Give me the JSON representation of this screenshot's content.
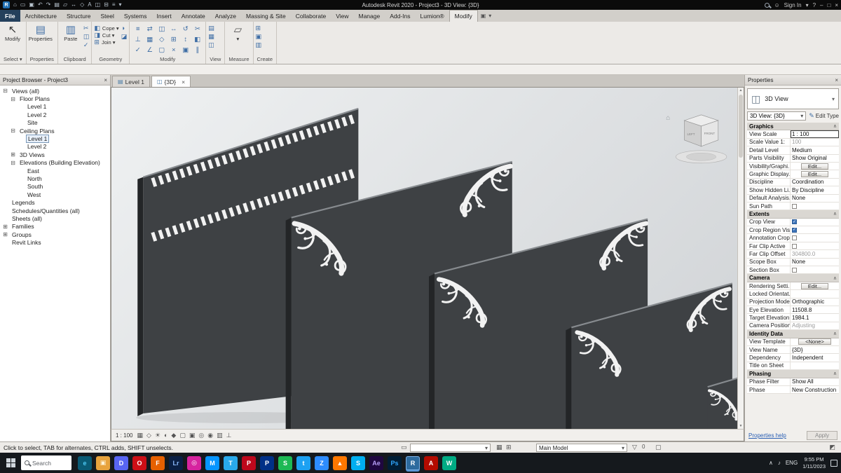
{
  "colors": {
    "accent": "#3c73b9",
    "panel_face": "#3e4144",
    "panel_side": "#232527",
    "ornament": "#f2f2f2",
    "taskbar_bg": "#15191d"
  },
  "title_bar": {
    "title": "Autodesk Revit 2020 - Project3 - 3D View: {3D}",
    "sign_in_label": "Sign In",
    "quick_access_icons": [
      {
        "name": "app-home-icon",
        "glyph": "⌂"
      },
      {
        "name": "open-file-icon",
        "glyph": "▭"
      },
      {
        "name": "save-icon",
        "glyph": "▣"
      },
      {
        "name": "undo-icon",
        "glyph": "↶"
      },
      {
        "name": "redo-icon",
        "glyph": "↷"
      },
      {
        "name": "print-icon",
        "glyph": "▤"
      },
      {
        "name": "measure-icon",
        "glyph": "▱"
      },
      {
        "name": "aligned-dimension-icon",
        "glyph": "↔"
      },
      {
        "name": "tag-icon",
        "glyph": "◇"
      },
      {
        "name": "text-icon",
        "glyph": "A"
      },
      {
        "name": "default-3d-view-icon",
        "glyph": "◫"
      },
      {
        "name": "section-icon",
        "glyph": "⊟"
      },
      {
        "name": "thin-lines-icon",
        "glyph": "≡"
      },
      {
        "name": "customize-qat-icon",
        "glyph": "▾"
      }
    ],
    "help_icon": "?",
    "minimize": "–",
    "maximize": "□",
    "close": "×",
    "user_icon": "☺",
    "workspace_arrow": "▾"
  },
  "ribbon": {
    "tabs": [
      "File",
      "Architecture",
      "Structure",
      "Steel",
      "Systems",
      "Insert",
      "Annotate",
      "Analyze",
      "Massing & Site",
      "Collaborate",
      "View",
      "Manage",
      "Add-Ins",
      "Lumion®",
      "Modify"
    ],
    "active_tab": "Modify",
    "extra_icons": [
      {
        "name": "modify-state-icon",
        "glyph": "▣"
      },
      {
        "name": "ribbon-collapse-icon",
        "glyph": "▾"
      }
    ],
    "panels": [
      {
        "label": "Select ▾",
        "big": [
          {
            "name": "modify-tool",
            "glyph": "↖",
            "text": "Modify",
            "color": "#333"
          }
        ]
      },
      {
        "label": "Properties",
        "big": [
          {
            "name": "properties",
            "glyph": "▤",
            "text": "Properties"
          }
        ]
      },
      {
        "label": "Clipboard",
        "big": [
          {
            "name": "paste",
            "glyph": "▥",
            "text": "Paste"
          }
        ],
        "small": [
          {
            "name": "cut-to-clipboard-icon",
            "glyph": "✂"
          },
          {
            "name": "copy-to-clipboard-icon",
            "glyph": "◫"
          },
          {
            "name": "match-type-icon",
            "glyph": "✓"
          }
        ]
      },
      {
        "label": "Geometry",
        "rows": [
          {
            "name": "cope",
            "glyph": "◧",
            "text": "Cope ▾"
          },
          {
            "name": "cut",
            "glyph": "◨",
            "text": "Cut ▾"
          },
          {
            "name": "join",
            "glyph": "⊞",
            "text": "Join ▾"
          }
        ],
        "small": [
          {
            "name": "paint-icon",
            "glyph": "◑"
          },
          {
            "name": "split-face-icon",
            "glyph": "◪"
          }
        ]
      },
      {
        "label": "Modify",
        "grid": [
          {
            "name": "align-icon",
            "glyph": "≡"
          },
          {
            "name": "offset-icon",
            "glyph": "⇄"
          },
          {
            "name": "mirror-icon",
            "glyph": "◫"
          },
          {
            "name": "move-icon",
            "glyph": "↔"
          },
          {
            "name": "rotate-icon",
            "glyph": "↺"
          },
          {
            "name": "split-element-icon",
            "glyph": "✂"
          },
          {
            "name": "trim-extend-icon",
            "glyph": "⊥"
          },
          {
            "name": "array-icon",
            "glyph": "▦"
          },
          {
            "name": "scale-icon",
            "glyph": "◇"
          },
          {
            "name": "copy-icon",
            "glyph": "⊞"
          },
          {
            "name": "move-vertical-icon",
            "glyph": "↕"
          },
          {
            "name": "cut-geometry-icon",
            "glyph": "◧"
          },
          {
            "name": "match-properties-icon",
            "glyph": "✓"
          },
          {
            "name": "measure-angle-icon",
            "glyph": "∠"
          },
          {
            "name": "pin-icon",
            "glyph": "▢"
          },
          {
            "name": "delete-icon",
            "glyph": "×"
          },
          {
            "name": "paint-small-icon",
            "glyph": "▣"
          },
          {
            "name": "wall-joins-icon",
            "glyph": "∥"
          }
        ]
      },
      {
        "label": "View",
        "small": [
          {
            "name": "thin-lines-icon",
            "glyph": "▤"
          },
          {
            "name": "user-interface-icon",
            "glyph": "▦"
          },
          {
            "name": "switch-windows-icon",
            "glyph": "◫"
          }
        ]
      },
      {
        "label": "Measure",
        "big": [
          {
            "name": "measure",
            "glyph": "▱",
            "text": "▾",
            "color": "#555"
          }
        ]
      },
      {
        "label": "Create",
        "small": [
          {
            "name": "create-group-icon",
            "glyph": "⊞"
          },
          {
            "name": "create-similar-icon",
            "glyph": "▣"
          },
          {
            "name": "load-family-icon",
            "glyph": "▥"
          }
        ]
      }
    ]
  },
  "project_browser": {
    "title": "Project Browser - Project3",
    "items": [
      {
        "label": "Views (all)",
        "level": 0,
        "exp": "minus"
      },
      {
        "label": "Floor Plans",
        "level": 1,
        "exp": "minus"
      },
      {
        "label": "Level 1",
        "level": 2
      },
      {
        "label": "Level 2",
        "level": 2
      },
      {
        "label": "Site",
        "level": 2
      },
      {
        "label": "Ceiling Plans",
        "level": 1,
        "exp": "minus"
      },
      {
        "label": "Level 1",
        "level": 2,
        "selected": true
      },
      {
        "label": "Level 2",
        "level": 2
      },
      {
        "label": "3D Views",
        "level": 1,
        "exp": "plus"
      },
      {
        "label": "Elevations (Building Elevation)",
        "level": 1,
        "exp": "minus"
      },
      {
        "label": "East",
        "level": 2
      },
      {
        "label": "North",
        "level": 2
      },
      {
        "label": "South",
        "level": 2
      },
      {
        "label": "West",
        "level": 2
      },
      {
        "label": "Legends",
        "level": 0
      },
      {
        "label": "Schedules/Quantities (all)",
        "level": 0
      },
      {
        "label": "Sheets (all)",
        "level": 0
      },
      {
        "label": "Families",
        "level": 0,
        "exp": "plus"
      },
      {
        "label": "Groups",
        "level": 0,
        "exp": "plus"
      },
      {
        "label": "Revit Links",
        "level": 0
      }
    ]
  },
  "viewport": {
    "view_tabs": [
      {
        "label": "Level 1",
        "icon": "▤",
        "active": false,
        "closable": false
      },
      {
        "label": "{3D}",
        "icon": "◫",
        "active": true,
        "closable": true
      }
    ],
    "close_glyph": "×",
    "view_scale": "1 : 100",
    "viewcube": {
      "front_label": "FRONT",
      "left_label": "LEFT",
      "home_glyph": "⌂"
    },
    "control_icons": [
      {
        "name": "detail-level-icon",
        "glyph": "▦"
      },
      {
        "name": "visual-style-icon",
        "glyph": "◇"
      },
      {
        "name": "sun-path-icon",
        "glyph": "☀"
      },
      {
        "name": "shadows-icon",
        "glyph": "◐"
      },
      {
        "name": "rendering-dialog-icon",
        "glyph": "◆"
      },
      {
        "name": "crop-view-icon",
        "glyph": "▢"
      },
      {
        "name": "show-crop-region-icon",
        "glyph": "▣"
      },
      {
        "name": "temporary-hide-isolate-icon",
        "glyph": "◎"
      },
      {
        "name": "reveal-hidden-elements-icon",
        "glyph": "◉"
      },
      {
        "name": "temporary-view-properties-icon",
        "glyph": "▥"
      },
      {
        "name": "constraints-icon",
        "glyph": "⊥"
      }
    ]
  },
  "properties_panel": {
    "title": "Properties",
    "element_type": "3D View",
    "type_selector": "3D View: {3D}",
    "edit_type_label": "Edit Type",
    "edit_type_icon": "✎",
    "sections": [
      {
        "title": "Graphics",
        "rows": [
          {
            "label": "View Scale",
            "value": "1 : 100",
            "kind": "focused"
          },
          {
            "label": "Scale Value    1:",
            "value": "100",
            "kind": "disabled"
          },
          {
            "label": "Detail Level",
            "value": "Medium",
            "kind": "text"
          },
          {
            "label": "Parts Visibility",
            "value": "Show Original",
            "kind": "text"
          },
          {
            "label": "Visibility/Graphi...",
            "value": "Edit...",
            "kind": "button"
          },
          {
            "label": "Graphic Display...",
            "value": "Edit...",
            "kind": "button"
          },
          {
            "label": "Discipline",
            "value": "Coordination",
            "kind": "text"
          },
          {
            "label": "Show Hidden Li...",
            "value": "By Discipline",
            "kind": "text"
          },
          {
            "label": "Default Analysis...",
            "value": "None",
            "kind": "text"
          },
          {
            "label": "Sun Path",
            "kind": "checkbox",
            "checked": false
          }
        ]
      },
      {
        "title": "Extents",
        "rows": [
          {
            "label": "Crop View",
            "kind": "checkbox",
            "checked": true
          },
          {
            "label": "Crop Region Vis...",
            "kind": "checkbox",
            "checked": true
          },
          {
            "label": "Annotation Crop",
            "kind": "checkbox",
            "checked": false
          },
          {
            "label": "Far Clip Active",
            "kind": "checkbox",
            "checked": false
          },
          {
            "label": "Far Clip Offset",
            "value": "304800.0",
            "kind": "disabled"
          },
          {
            "label": "Scope Box",
            "value": "None",
            "kind": "text"
          },
          {
            "label": "Section Box",
            "kind": "checkbox",
            "checked": false
          }
        ]
      },
      {
        "title": "Camera",
        "rows": [
          {
            "label": "Rendering Setti...",
            "value": "Edit...",
            "kind": "button"
          },
          {
            "label": "Locked Orientat...",
            "value": "",
            "kind": "disabled"
          },
          {
            "label": "Projection Mode",
            "value": "Orthographic",
            "kind": "text"
          },
          {
            "label": "Eye Elevation",
            "value": "11508.8",
            "kind": "text"
          },
          {
            "label": "Target Elevation",
            "value": "1984.1",
            "kind": "text"
          },
          {
            "label": "Camera Position",
            "value": "Adjusting",
            "kind": "disabled"
          }
        ]
      },
      {
        "title": "Identity Data",
        "rows": [
          {
            "label": "View Template",
            "value": "<None>",
            "kind": "button"
          },
          {
            "label": "View Name",
            "value": "{3D}",
            "kind": "text"
          },
          {
            "label": "Dependency",
            "value": "Independent",
            "kind": "text"
          },
          {
            "label": "Title on Sheet",
            "value": "",
            "kind": "text"
          }
        ]
      },
      {
        "title": "Phasing",
        "rows": [
          {
            "label": "Phase Filter",
            "value": "Show All",
            "kind": "text"
          },
          {
            "label": "Phase",
            "value": "New Construction",
            "kind": "text"
          }
        ]
      }
    ],
    "help_link": "Properties help",
    "apply_label": "Apply"
  },
  "status_bar": {
    "hint": "Click to select, TAB for alternates, CTRL adds, SHIFT unselects.",
    "main_model_label": "Main Model",
    "exclusion_count": "0"
  },
  "taskbar": {
    "search_placeholder": "Search",
    "apps": [
      {
        "name": "edge",
        "glyph": "e",
        "bg": "#0a5a74",
        "fg": "#4ec9f5"
      },
      {
        "name": "file-explorer",
        "glyph": "▣",
        "bg": "#e8a33d",
        "fg": "#fff3d6"
      },
      {
        "name": "discord",
        "glyph": "D",
        "bg": "#5865f2"
      },
      {
        "name": "opera",
        "glyph": "O",
        "bg": "#cc0f16"
      },
      {
        "name": "firefox",
        "glyph": "F",
        "bg": "#e66000"
      },
      {
        "name": "lightroom",
        "glyph": "Lr",
        "bg": "#0a1f44",
        "fg": "#8ab7f8"
      },
      {
        "name": "instagram",
        "glyph": "◎",
        "bg": "#d6249f"
      },
      {
        "name": "messenger",
        "glyph": "M",
        "bg": "#0695ff"
      },
      {
        "name": "telegram",
        "glyph": "T",
        "bg": "#29a9eb"
      },
      {
        "name": "pinterest",
        "glyph": "P",
        "bg": "#bd081c"
      },
      {
        "name": "paypal",
        "glyph": "P",
        "bg": "#003087"
      },
      {
        "name": "spotify",
        "glyph": "S",
        "bg": "#1db954"
      },
      {
        "name": "twitter",
        "glyph": "t",
        "bg": "#1da1f2"
      },
      {
        "name": "zoom",
        "glyph": "Z",
        "bg": "#2d8cff"
      },
      {
        "name": "vlc",
        "glyph": "▲",
        "bg": "#ff7800"
      },
      {
        "name": "skype",
        "glyph": "S",
        "bg": "#00aff0"
      },
      {
        "name": "after-effects",
        "glyph": "Ae",
        "bg": "#1f0740",
        "fg": "#b59df5"
      },
      {
        "name": "photoshop",
        "glyph": "Ps",
        "bg": "#001e36",
        "fg": "#31a8ff"
      },
      {
        "name": "revit",
        "glyph": "R",
        "bg": "#2e6b9e",
        "active": true
      },
      {
        "name": "acrobat",
        "glyph": "A",
        "bg": "#b30b00"
      },
      {
        "name": "webex",
        "glyph": "W",
        "bg": "#00ab84"
      }
    ],
    "tray": {
      "chevron": "∧",
      "sound_icon": "♪",
      "lang": "ENG",
      "time": "9:55 PM",
      "date": "1/11/2023"
    }
  }
}
